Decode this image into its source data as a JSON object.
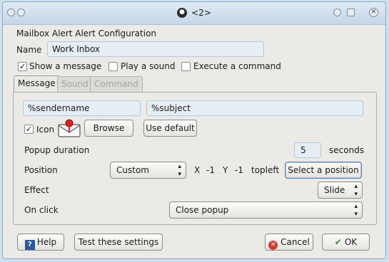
{
  "window": {
    "title": "<2>"
  },
  "form": {
    "heading": "Mailbox Alert Alert Configuration",
    "name_label": "Name",
    "name_value": "Work Inbox",
    "show_message_label": "Show a message",
    "play_sound_label": "Play a sound",
    "execute_command_label": "Execute a command"
  },
  "tabs": [
    {
      "label": "Message",
      "active": true
    },
    {
      "label": "Sound",
      "active": false
    },
    {
      "label": "Command",
      "active": false
    }
  ],
  "message": {
    "sender_field": "%sendername",
    "subject_field": "%subject",
    "icon_label": "Icon",
    "browse_label": "Browse",
    "use_default_label": "Use default",
    "popup_duration_label": "Popup duration",
    "popup_duration_value": "5",
    "seconds_label": "seconds",
    "position_label": "Position",
    "position_value": "Custom",
    "x_label": "X",
    "x_value": "-1",
    "y_label": "Y",
    "y_value": "-1",
    "anchor_value": "topleft",
    "select_position_label": "Select a position",
    "effect_label": "Effect",
    "effect_value": "Slide",
    "on_click_label": "On click",
    "on_click_value": "Close popup"
  },
  "footer": {
    "help_label": "Help",
    "test_label": "Test these settings",
    "cancel_label": "Cancel",
    "ok_label": "OK"
  },
  "checked": {
    "show_message": true,
    "play_sound": false,
    "execute_command": false,
    "icon": true
  },
  "icons": {
    "title": "tux-icon",
    "mail": "mail-alert-icon",
    "help": "help-icon",
    "cancel": "cancel-icon",
    "ok": "ok-check-icon"
  },
  "colors": {
    "window_bg": "#eceae6",
    "titlebar": "#c5d7e9",
    "input_bg": "#e6eef5",
    "cancel_red": "#d63b2f",
    "ok_green": "#3a8a2a"
  }
}
